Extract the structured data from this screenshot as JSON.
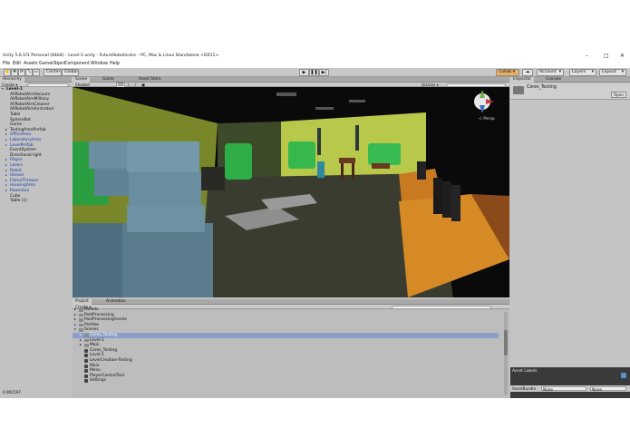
{
  "window": {
    "title": "Unity 5.6.1f1 Personal (64bit) - Level-1.unity - FutureRoboticsInc - PC, Mac & Linux Standalone <DX11>",
    "controls": [
      "–",
      "□",
      "✕"
    ]
  },
  "menu": [
    "File",
    "Edit",
    "Assets",
    "GameObject",
    "Component",
    "Window",
    "Help"
  ],
  "toolbar": {
    "pivot": "Center",
    "space": "Global",
    "collab": "Collab ▾",
    "account": "Account",
    "layers": "Layers",
    "layout": "Layout"
  },
  "hierarchy": {
    "tab": "Hierarchy",
    "create": "Create ▾",
    "search_placeholder": "All",
    "scene_name": "Level-1",
    "items": [
      {
        "label": "AllRobotAimVacuum",
        "indent": 1,
        "prefab": false,
        "arrow": ""
      },
      {
        "label": "AllRobotAimMilitary",
        "indent": 1,
        "prefab": false,
        "arrow": ""
      },
      {
        "label": "AllRobotAimCleaner",
        "indent": 1,
        "prefab": false,
        "arrow": ""
      },
      {
        "label": "AllRobotAimAnimated",
        "indent": 1,
        "prefab": false,
        "arrow": ""
      },
      {
        "label": "Table",
        "indent": 1,
        "prefab": false,
        "arrow": ""
      },
      {
        "label": "SphereBot",
        "indent": 1,
        "prefab": false,
        "arrow": ""
      },
      {
        "label": "Game",
        "indent": 1,
        "prefab": false,
        "arrow": ""
      },
      {
        "label": "TestingAreaPrefab",
        "indent": 1,
        "prefab": false,
        "arrow": "▸"
      },
      {
        "label": "OfficeArea",
        "indent": 1,
        "prefab": true,
        "arrow": "▸"
      },
      {
        "label": "LaboratoryArea",
        "indent": 1,
        "prefab": true,
        "arrow": "▸"
      },
      {
        "label": "LevelPrefab",
        "indent": 1,
        "prefab": true,
        "arrow": "▸"
      },
      {
        "label": "EventSystem",
        "indent": 1,
        "prefab": false,
        "arrow": ""
      },
      {
        "label": "Directional light",
        "indent": 1,
        "prefab": false,
        "arrow": ""
      },
      {
        "label": "Player",
        "indent": 1,
        "prefab": true,
        "arrow": "▸"
      },
      {
        "label": "Lasers",
        "indent": 1,
        "prefab": true,
        "arrow": "▸"
      },
      {
        "label": "Robot",
        "indent": 1,
        "prefab": true,
        "arrow": "▸"
      },
      {
        "label": "Hoover",
        "indent": 1,
        "prefab": true,
        "arrow": "▸"
      },
      {
        "label": "FlameThrower",
        "indent": 1,
        "prefab": true,
        "arrow": "▸"
      },
      {
        "label": "HousingArea",
        "indent": 1,
        "prefab": true,
        "arrow": "▸"
      },
      {
        "label": "Powerbox",
        "indent": 1,
        "prefab": true,
        "arrow": "▸"
      },
      {
        "label": "Cube",
        "indent": 1,
        "prefab": false,
        "arrow": ""
      },
      {
        "label": "Table (1)",
        "indent": 1,
        "prefab": false,
        "arrow": ""
      }
    ]
  },
  "scene": {
    "tabs": [
      "Scene",
      "Game",
      "Asset Store"
    ],
    "shading": "Shaded",
    "mode_2d": "2D",
    "gizmos": "Gizmos ▾",
    "search_placeholder": "All",
    "persp_label": "< Persp"
  },
  "project": {
    "tabs": [
      "Project",
      "Animation"
    ],
    "create": "Create ▾",
    "rows": [
      {
        "label": "Models",
        "depth": 0,
        "type": "folder",
        "selected": false,
        "arrow": "▸"
      },
      {
        "label": "PostProcessing",
        "depth": 0,
        "type": "folder",
        "selected": false,
        "arrow": "▸"
      },
      {
        "label": "PostProcessingAssets",
        "depth": 0,
        "type": "folder",
        "selected": false,
        "arrow": "▸"
      },
      {
        "label": "Prefabs",
        "depth": 0,
        "type": "folder",
        "selected": false,
        "arrow": "▸"
      },
      {
        "label": "Scenes",
        "depth": 0,
        "type": "folder",
        "selected": false,
        "arrow": "▾"
      },
      {
        "label": "Cores_Testing",
        "depth": 1,
        "type": "folder",
        "selected": true,
        "arrow": "▸"
      },
      {
        "label": "Level-1",
        "depth": 1,
        "type": "folder",
        "selected": false,
        "arrow": "▸"
      },
      {
        "label": "Main",
        "depth": 1,
        "type": "folder",
        "selected": false,
        "arrow": "▸"
      },
      {
        "label": "Cores_Testing",
        "depth": 1,
        "type": "scene",
        "selected": false,
        "arrow": ""
      },
      {
        "label": "Level-1",
        "depth": 1,
        "type": "scene",
        "selected": false,
        "arrow": ""
      },
      {
        "label": "LevelCreation-Testing",
        "depth": 1,
        "type": "scene",
        "selected": false,
        "arrow": ""
      },
      {
        "label": "Main",
        "depth": 1,
        "type": "scene",
        "selected": false,
        "arrow": ""
      },
      {
        "label": "Menu",
        "depth": 1,
        "type": "scene",
        "selected": false,
        "arrow": ""
      },
      {
        "label": "PlayerControlTest",
        "depth": 1,
        "type": "scene",
        "selected": false,
        "arrow": ""
      },
      {
        "label": "Settings",
        "depth": 1,
        "type": "scene",
        "selected": false,
        "arrow": ""
      }
    ]
  },
  "inspector": {
    "tabs": [
      "Inspector",
      "Console"
    ],
    "object_name": "Cores_Testing",
    "open_button": "Open",
    "asset_labels": "Asset Labels",
    "asset_bundle_label": "AssetBundle",
    "asset_bundle_value": "None",
    "asset_bundle_variant": "None"
  },
  "status": {
    "text": "0.961597"
  },
  "colors": {
    "wall_left": "#7d8a2a",
    "wall_right": "#b9c94a",
    "floor": "#3a3d2e",
    "chair_green": "#33b94a",
    "barrel": "#6e8fa0",
    "table_orange": "#d88a24",
    "ceiling": "#0c0c0c"
  }
}
